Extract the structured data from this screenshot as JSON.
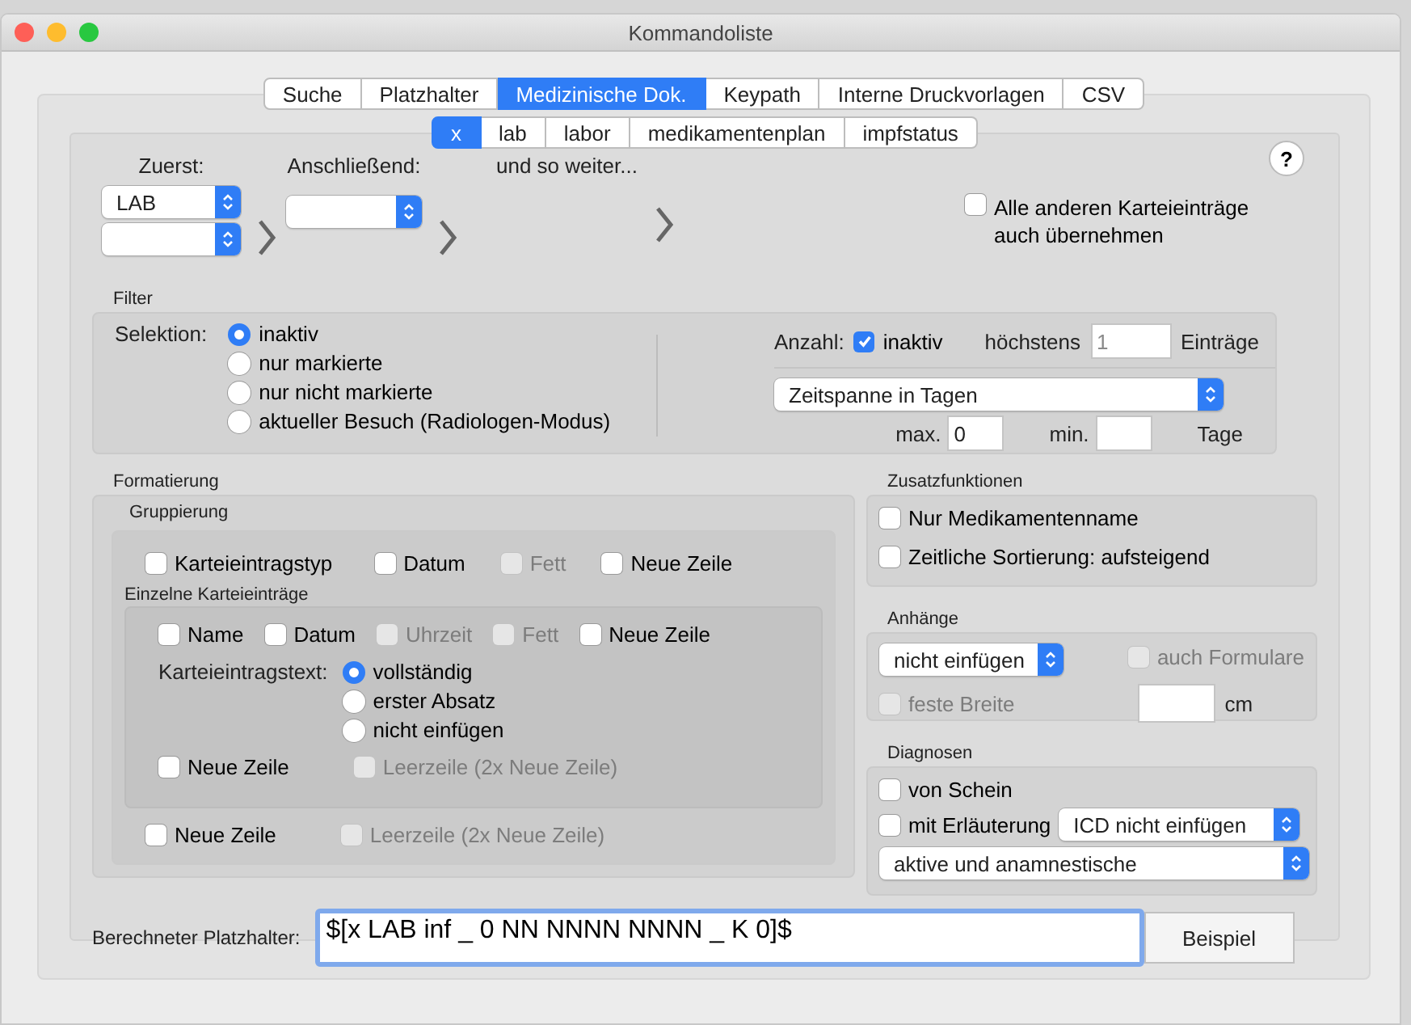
{
  "window": {
    "title": "Kommandoliste"
  },
  "tabs": [
    {
      "label": "Suche",
      "selected": false
    },
    {
      "label": "Platzhalter",
      "selected": false
    },
    {
      "label": "Medizinische Dok.",
      "selected": true
    },
    {
      "label": "Keypath",
      "selected": false
    },
    {
      "label": "Interne Druckvorlagen",
      "selected": false
    },
    {
      "label": "CSV",
      "selected": false
    }
  ],
  "subtabs": [
    {
      "label": "x",
      "selected": true
    },
    {
      "label": "lab",
      "selected": false
    },
    {
      "label": "labor",
      "selected": false
    },
    {
      "label": "medikamentenplan",
      "selected": false
    },
    {
      "label": "impfstatus",
      "selected": false
    }
  ],
  "order": {
    "first_label": "Zuerst:",
    "first_value": "LAB",
    "then_label": "Anschließend:",
    "etc_label": "und so weiter..."
  },
  "help": {
    "label": "?"
  },
  "copy_all": {
    "label": "Alle anderen Karteieinträge auch übernehmen",
    "checked": false,
    "disabled": false
  },
  "filter": {
    "title": "Filter",
    "selection_label": "Selektion:",
    "options": [
      {
        "label": "inaktiv",
        "selected": true
      },
      {
        "label": "nur markierte",
        "selected": false
      },
      {
        "label": "nur nicht markierte",
        "selected": false
      },
      {
        "label": "aktueller Besuch (Radiologen-Modus)",
        "selected": false
      }
    ],
    "count_label": "Anzahl:",
    "count_inactive": {
      "label": "inaktiv",
      "checked": true,
      "disabled": false
    },
    "max_label": "höchstens",
    "max_entries": {
      "placeholder": "1",
      "disabled": true
    },
    "entries_label": "Einträge",
    "period": "Zeitspanne in Tagen",
    "max_days_label": "max.",
    "max_days": "0",
    "min_days_label": "min.",
    "days_label": "Tage"
  },
  "formatting": {
    "title": "Formatierung",
    "grouping": {
      "title": "Gruppierung",
      "checkboxes": [
        {
          "label": "Karteieintragstyp",
          "checked": false,
          "disabled": false
        },
        {
          "label": "Datum",
          "checked": false,
          "disabled": false
        },
        {
          "label": "Fett",
          "checked": false,
          "disabled": true
        },
        {
          "label": "Neue Zeile",
          "checked": false,
          "disabled": false
        }
      ],
      "bottom_checkboxes": [
        {
          "label": "Neue Zeile",
          "checked": false,
          "disabled": false
        },
        {
          "label": "Leerzeile (2x Neue Zeile)",
          "checked": false,
          "disabled": true
        }
      ]
    },
    "single": {
      "title": "Einzelne Karteieinträge",
      "checkboxes": [
        {
          "label": "Name",
          "checked": false,
          "disabled": false
        },
        {
          "label": "Datum",
          "checked": false,
          "disabled": false
        },
        {
          "label": "Uhrzeit",
          "checked": false,
          "disabled": true
        },
        {
          "label": "Fett",
          "checked": false,
          "disabled": true
        },
        {
          "label": "Neue Zeile",
          "checked": false,
          "disabled": false
        }
      ],
      "text_label": "Karteieintragstext:",
      "text_options": [
        {
          "label": "vollständig",
          "selected": true
        },
        {
          "label": "erster Absatz",
          "selected": false
        },
        {
          "label": "nicht einfügen",
          "selected": false
        }
      ],
      "bottom_checkboxes": [
        {
          "label": "Neue Zeile",
          "checked": false,
          "disabled": false
        },
        {
          "label": "Leerzeile (2x Neue Zeile)",
          "checked": false,
          "disabled": true
        }
      ]
    }
  },
  "extras": {
    "title": "Zusatzfunktionen",
    "checkboxes": [
      {
        "label": "Nur Medikamentenname",
        "checked": false,
        "disabled": false
      },
      {
        "label": "Zeitliche Sortierung: aufsteigend",
        "checked": false,
        "disabled": false
      }
    ]
  },
  "attachments": {
    "title": "Anhänge",
    "popup": "nicht einfügen",
    "forms": {
      "label": "auch Formulare",
      "checked": false,
      "disabled": true
    },
    "fixed_width": {
      "label": "feste Breite",
      "checked": false,
      "disabled": true
    },
    "unit": "cm"
  },
  "diagnoses": {
    "title": "Diagnosen",
    "from_form": {
      "label": "von Schein",
      "checked": false,
      "disabled": false
    },
    "with_note": {
      "label": "mit Erläuterung",
      "checked": false,
      "disabled": false
    },
    "icd_popup": "ICD nicht einfügen",
    "kind_popup": "aktive und anamnestische"
  },
  "computed": {
    "label": "Berechneter Platzhalter:",
    "value": "$[x LAB inf _ 0 NN NNNN NNNN _ K 0]$",
    "button": "Beispiel"
  }
}
